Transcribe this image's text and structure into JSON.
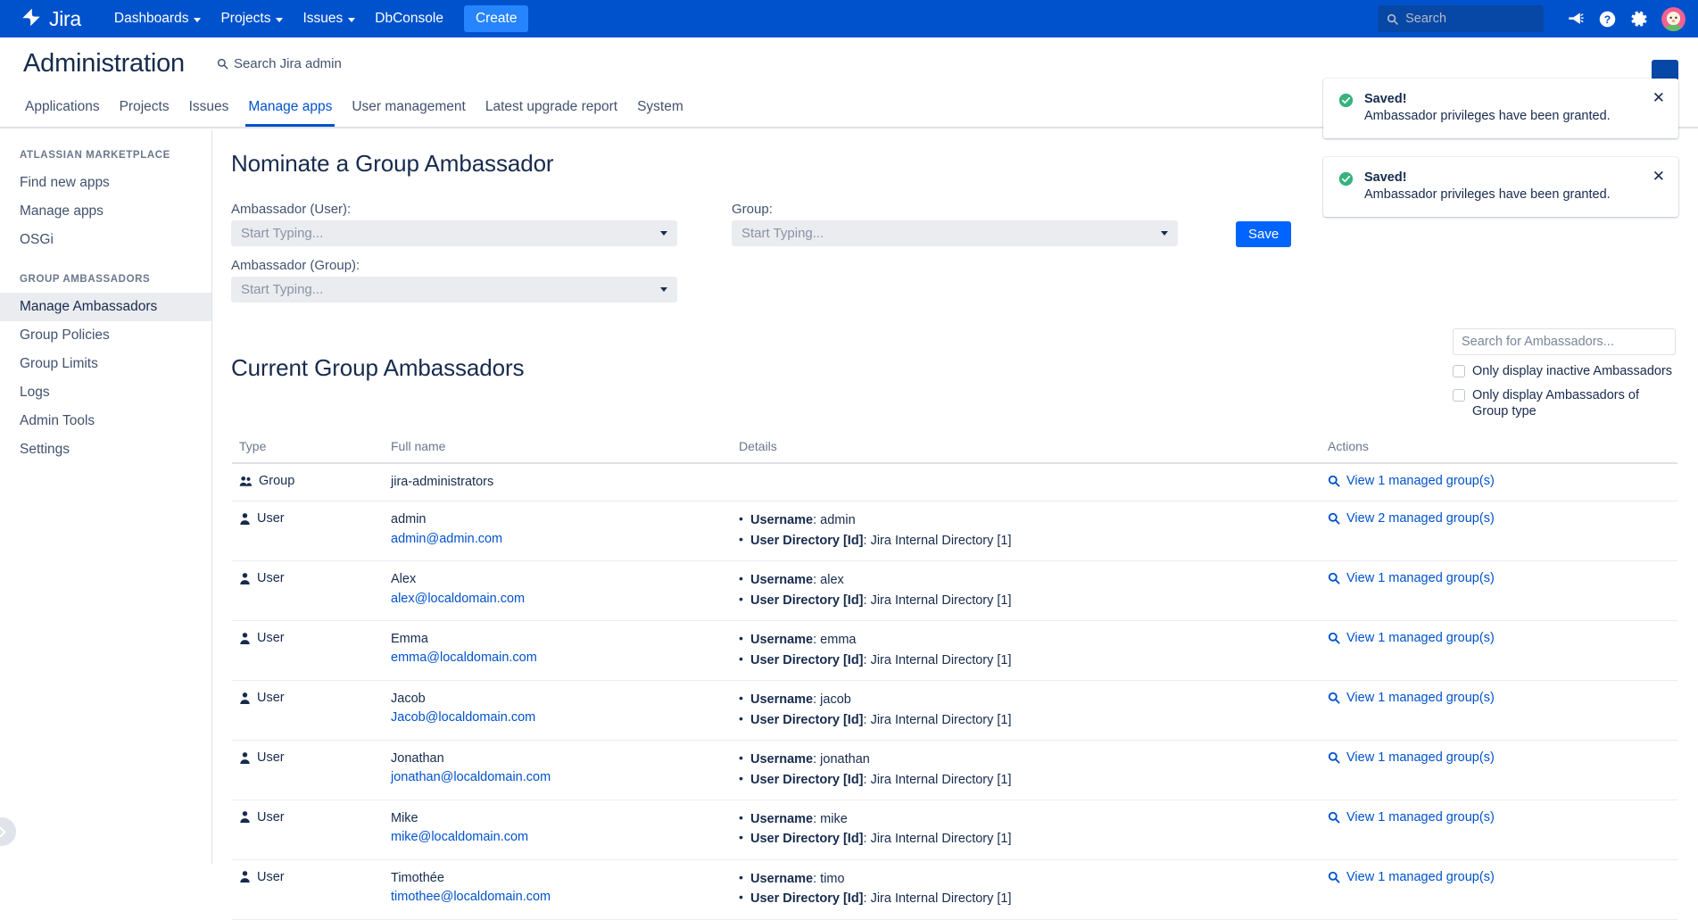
{
  "topnav": {
    "brand": "Jira",
    "brand_icon": "jira-logo-icon",
    "items": [
      {
        "label": "Dashboards",
        "has_caret": true
      },
      {
        "label": "Projects",
        "has_caret": true
      },
      {
        "label": "Issues",
        "has_caret": true
      },
      {
        "label": "DbConsole",
        "has_caret": false
      }
    ],
    "create_label": "Create",
    "search_placeholder": "Search",
    "search_value": "",
    "icons": [
      "search-icon",
      "megaphone-icon",
      "help-icon",
      "settings-icon",
      "avatar"
    ],
    "brand_bg": "#0052CC",
    "create_bg": "#2684FF"
  },
  "admin": {
    "title": "Administration",
    "search_label": "Search Jira admin",
    "tabs": [
      {
        "label": "Applications",
        "active": false
      },
      {
        "label": "Projects",
        "active": false
      },
      {
        "label": "Issues",
        "active": false
      },
      {
        "label": "Manage apps",
        "active": true
      },
      {
        "label": "User management",
        "active": false
      },
      {
        "label": "Latest upgrade report",
        "active": false
      },
      {
        "label": "System",
        "active": false
      }
    ],
    "active_color": "#0052CC"
  },
  "sidebar": {
    "groups": [
      {
        "label": "ATLASSIAN MARKETPLACE",
        "items": [
          {
            "label": "Find new apps",
            "active": false
          },
          {
            "label": "Manage apps",
            "active": false
          },
          {
            "label": "OSGi",
            "active": false
          }
        ]
      },
      {
        "label": "GROUP AMBASSADORS",
        "items": [
          {
            "label": "Manage Ambassadors",
            "active": true
          },
          {
            "label": "Group Policies",
            "active": false
          },
          {
            "label": "Group Limits",
            "active": false
          },
          {
            "label": "Logs",
            "active": false
          },
          {
            "label": "Admin Tools",
            "active": false
          },
          {
            "label": "Settings",
            "active": false
          }
        ]
      }
    ]
  },
  "nominate": {
    "heading": "Nominate a Group Ambassador",
    "user_label": "Ambassador (User):",
    "user_value": "Start Typing...",
    "group_ambassador_label": "Ambassador (Group):",
    "group_ambassador_value": "Start Typing...",
    "group_label": "Group:",
    "group_value": "Start Typing...",
    "save_label": "Save"
  },
  "current": {
    "heading": "Current Group Ambassadors",
    "search_placeholder": "Search for Ambassadors...",
    "search_value": "",
    "checkbox_inactive": "Only display inactive Ambassadors",
    "checkbox_grouptype": "Only display Ambassadors of Group type",
    "checkbox_inactive_checked": false,
    "checkbox_grouptype_checked": false,
    "columns": [
      "Type",
      "Full name",
      "Details",
      "Actions"
    ],
    "detail_keys": {
      "username": "Username",
      "directory": "User Directory [Id]"
    },
    "rows": [
      {
        "type": "Group",
        "type_icon": "group-icon",
        "name": "jira-administrators",
        "email": "",
        "username": "",
        "directory": "",
        "action": "View 1 managed group(s)",
        "action_icon": "search-icon"
      },
      {
        "type": "User",
        "type_icon": "user-icon",
        "name": "admin",
        "email": "admin@admin.com",
        "username": "admin",
        "directory": "Jira Internal Directory [1]",
        "action": "View 2 managed group(s)",
        "action_icon": "search-icon"
      },
      {
        "type": "User",
        "type_icon": "user-icon",
        "name": "Alex",
        "email": "alex@localdomain.com",
        "username": "alex",
        "directory": "Jira Internal Directory [1]",
        "action": "View 1 managed group(s)",
        "action_icon": "search-icon"
      },
      {
        "type": "User",
        "type_icon": "user-icon",
        "name": "Emma",
        "email": "emma@localdomain.com",
        "username": "emma",
        "directory": "Jira Internal Directory [1]",
        "action": "View 1 managed group(s)",
        "action_icon": "search-icon"
      },
      {
        "type": "User",
        "type_icon": "user-icon",
        "name": "Jacob",
        "email": "Jacob@localdomain.com",
        "username": "jacob",
        "directory": "Jira Internal Directory [1]",
        "action": "View 1 managed group(s)",
        "action_icon": "search-icon"
      },
      {
        "type": "User",
        "type_icon": "user-icon",
        "name": "Jonathan",
        "email": "jonathan@localdomain.com",
        "username": "jonathan",
        "directory": "Jira Internal Directory [1]",
        "action": "View 1 managed group(s)",
        "action_icon": "search-icon"
      },
      {
        "type": "User",
        "type_icon": "user-icon",
        "name": "Mike",
        "email": "mike@localdomain.com",
        "username": "mike",
        "directory": "Jira Internal Directory [1]",
        "action": "View 1 managed group(s)",
        "action_icon": "search-icon"
      },
      {
        "type": "User",
        "type_icon": "user-icon",
        "name": "Timothée",
        "email": "timothee@localdomain.com",
        "username": "timo",
        "directory": "Jira Internal Directory [1]",
        "action": "View 1 managed group(s)",
        "action_icon": "search-icon"
      }
    ]
  },
  "toasts": [
    {
      "title": "Saved!",
      "body": "Ambassador privileges have been granted.",
      "icon": "success-check-icon",
      "icon_color": "#36B37E",
      "close_icon": "close-icon"
    },
    {
      "title": "Saved!",
      "body": "Ambassador privileges have been granted.",
      "icon": "success-check-icon",
      "icon_color": "#36B37E",
      "close_icon": "close-icon"
    }
  ],
  "expand_handle_icon": "chevron-right-icon"
}
